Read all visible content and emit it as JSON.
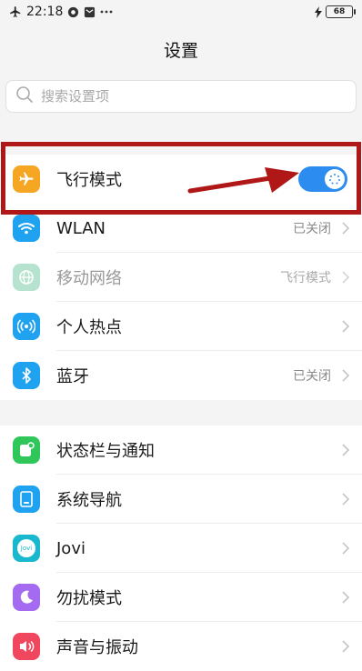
{
  "status_bar": {
    "time": "22:18",
    "battery": "68",
    "icons": [
      "airplane-icon",
      "record-icon",
      "message-icon",
      "more-icon",
      "charging-icon",
      "battery-icon"
    ]
  },
  "header": {
    "title": "设置"
  },
  "search": {
    "placeholder": "搜索设置项",
    "value": ""
  },
  "section1": {
    "items": [
      {
        "label": "飞行模式",
        "icon": "airplane-icon",
        "color": "#f5a623",
        "toggle": true
      },
      {
        "label": "WLAN",
        "icon": "wifi-icon",
        "color": "#1fa2f0",
        "value": "已关闭"
      },
      {
        "label": "移动网络",
        "icon": "globe-icon",
        "color": "#b5e3cf",
        "value": "飞行模式",
        "disabled": true
      },
      {
        "label": "个人热点",
        "icon": "hotspot-icon",
        "color": "#1fa2f0"
      },
      {
        "label": "蓝牙",
        "icon": "bluetooth-icon",
        "color": "#1fa2f0",
        "value": "已关闭"
      }
    ]
  },
  "section2": {
    "items": [
      {
        "label": "状态栏与通知",
        "icon": "notification-icon",
        "color": "#2fc65a"
      },
      {
        "label": "系统导航",
        "icon": "navigation-icon",
        "color": "#1fa2f0"
      },
      {
        "label": "Jovi",
        "icon": "jovi-icon",
        "color": "#1ab8cf",
        "icon_text": "Jovi"
      },
      {
        "label": "勿扰模式",
        "icon": "moon-icon",
        "color": "#a46bf0"
      },
      {
        "label": "声音与振动",
        "icon": "speaker-icon",
        "color": "#f0475e"
      }
    ]
  },
  "annotation": {
    "color": "#b01818"
  }
}
